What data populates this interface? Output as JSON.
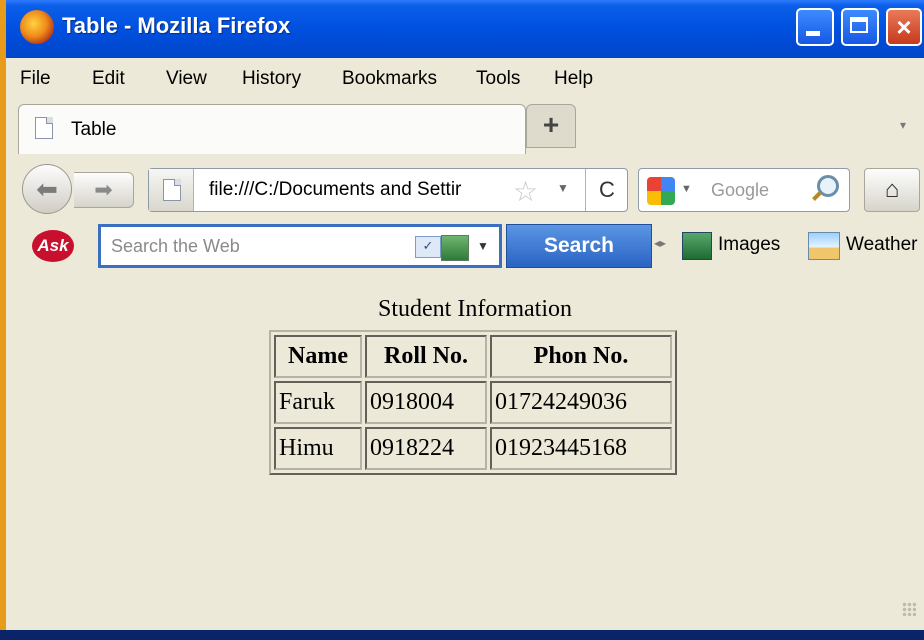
{
  "window": {
    "title": "Table - Mozilla Firefox"
  },
  "menu": [
    "File",
    "Edit",
    "View",
    "History",
    "Bookmarks",
    "Tools",
    "Help"
  ],
  "tabs": [
    {
      "label": "Table"
    }
  ],
  "new_tab_label": "+",
  "navbar": {
    "url": "file:///C:/Documents and Settir",
    "search_engine_label": "Google",
    "reload_glyph": "C"
  },
  "askbar": {
    "logo": "Ask",
    "placeholder": "Search the Web",
    "search_button": "Search",
    "images_label": "Images",
    "weather_label": "Weather"
  },
  "content": {
    "caption": "Student Information",
    "table": {
      "headers": [
        "Name",
        "Roll No.",
        "Phon No."
      ],
      "rows": [
        [
          "Faruk",
          "0918004",
          "01724249036"
        ],
        [
          "Himu",
          "0918224",
          "01923445168"
        ]
      ]
    }
  },
  "colors": {
    "titlebar": "#0054e3",
    "chrome": "#ece9d8",
    "search_button": "#2a64c4",
    "ask_logo": "#c8102e"
  }
}
